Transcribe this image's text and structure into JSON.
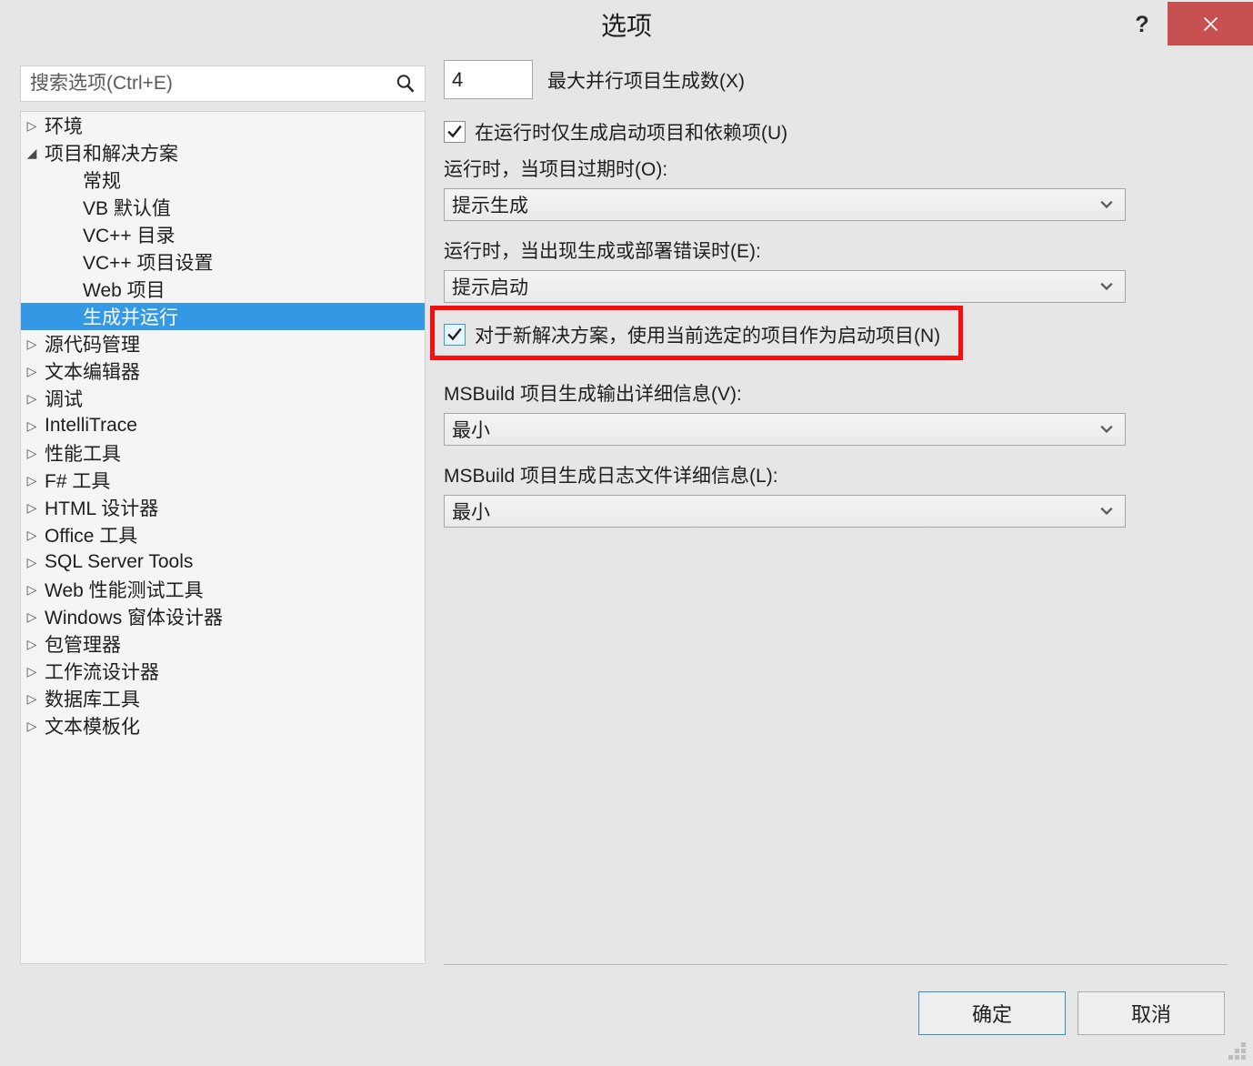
{
  "window": {
    "title": "选项",
    "help_icon": "question-mark-icon",
    "close_icon": "close-x-icon",
    "close_button_color": "#c75050"
  },
  "search": {
    "placeholder": "搜索选项(Ctrl+E)",
    "value": "",
    "icon": "search-icon"
  },
  "tree": {
    "selected_index": 6,
    "selection_color": "#3399e5",
    "items": [
      {
        "label": "环境",
        "level": 1,
        "state": "collapsed",
        "arrow": "▷"
      },
      {
        "label": "项目和解决方案",
        "level": 1,
        "state": "expanded",
        "arrow": "◢"
      },
      {
        "label": "常规",
        "level": 2,
        "state": "leaf",
        "arrow": ""
      },
      {
        "label": "VB 默认值",
        "level": 2,
        "state": "leaf",
        "arrow": ""
      },
      {
        "label": "VC++ 目录",
        "level": 2,
        "state": "leaf",
        "arrow": ""
      },
      {
        "label": "VC++ 项目设置",
        "level": 2,
        "state": "leaf",
        "arrow": ""
      },
      {
        "label": "Web 项目",
        "level": 2,
        "state": "leaf",
        "arrow": ""
      },
      {
        "label": "生成并运行",
        "level": 2,
        "state": "leaf",
        "arrow": "",
        "selected": true
      },
      {
        "label": "源代码管理",
        "level": 1,
        "state": "collapsed",
        "arrow": "▷"
      },
      {
        "label": "文本编辑器",
        "level": 1,
        "state": "collapsed",
        "arrow": "▷"
      },
      {
        "label": "调试",
        "level": 1,
        "state": "collapsed",
        "arrow": "▷"
      },
      {
        "label": "IntelliTrace",
        "level": 1,
        "state": "collapsed",
        "arrow": "▷"
      },
      {
        "label": "性能工具",
        "level": 1,
        "state": "collapsed",
        "arrow": "▷"
      },
      {
        "label": "F# 工具",
        "level": 1,
        "state": "collapsed",
        "arrow": "▷"
      },
      {
        "label": "HTML 设计器",
        "level": 1,
        "state": "collapsed",
        "arrow": "▷"
      },
      {
        "label": "Office 工具",
        "level": 1,
        "state": "collapsed",
        "arrow": "▷"
      },
      {
        "label": "SQL Server Tools",
        "level": 1,
        "state": "collapsed",
        "arrow": "▷"
      },
      {
        "label": "Web 性能测试工具",
        "level": 1,
        "state": "collapsed",
        "arrow": "▷"
      },
      {
        "label": "Windows 窗体设计器",
        "level": 1,
        "state": "collapsed",
        "arrow": "▷"
      },
      {
        "label": "包管理器",
        "level": 1,
        "state": "collapsed",
        "arrow": "▷"
      },
      {
        "label": "工作流设计器",
        "level": 1,
        "state": "collapsed",
        "arrow": "▷"
      },
      {
        "label": "数据库工具",
        "level": 1,
        "state": "collapsed",
        "arrow": "▷"
      },
      {
        "label": "文本模板化",
        "level": 1,
        "state": "collapsed",
        "arrow": "▷"
      }
    ]
  },
  "options": {
    "max_parallel": {
      "value": "4",
      "label": "最大并行项目生成数(X)"
    },
    "only_build_startup": {
      "label": "在运行时仅生成启动项目和依赖项(U)",
      "checked": true,
      "focused": false
    },
    "on_run_outdated": {
      "label": "运行时，当项目过期时(O):",
      "value": "提示生成"
    },
    "on_run_errors": {
      "label": "运行时，当出现生成或部署错误时(E):",
      "value": "提示启动"
    },
    "new_solution_startup": {
      "label": "对于新解决方案，使用当前选定的项目作为启动项目(N)",
      "checked": true,
      "focused": true,
      "highlight_color": "#fb0b0b"
    },
    "msbuild_output_verbosity": {
      "label": "MSBuild 项目生成输出详细信息(V):",
      "value": "最小"
    },
    "msbuild_log_verbosity": {
      "label": "MSBuild 项目生成日志文件详细信息(L):",
      "value": "最小"
    }
  },
  "footer": {
    "ok_label": "确定",
    "cancel_label": "取消",
    "resize_grip_icon": "resize-grip-icon"
  }
}
